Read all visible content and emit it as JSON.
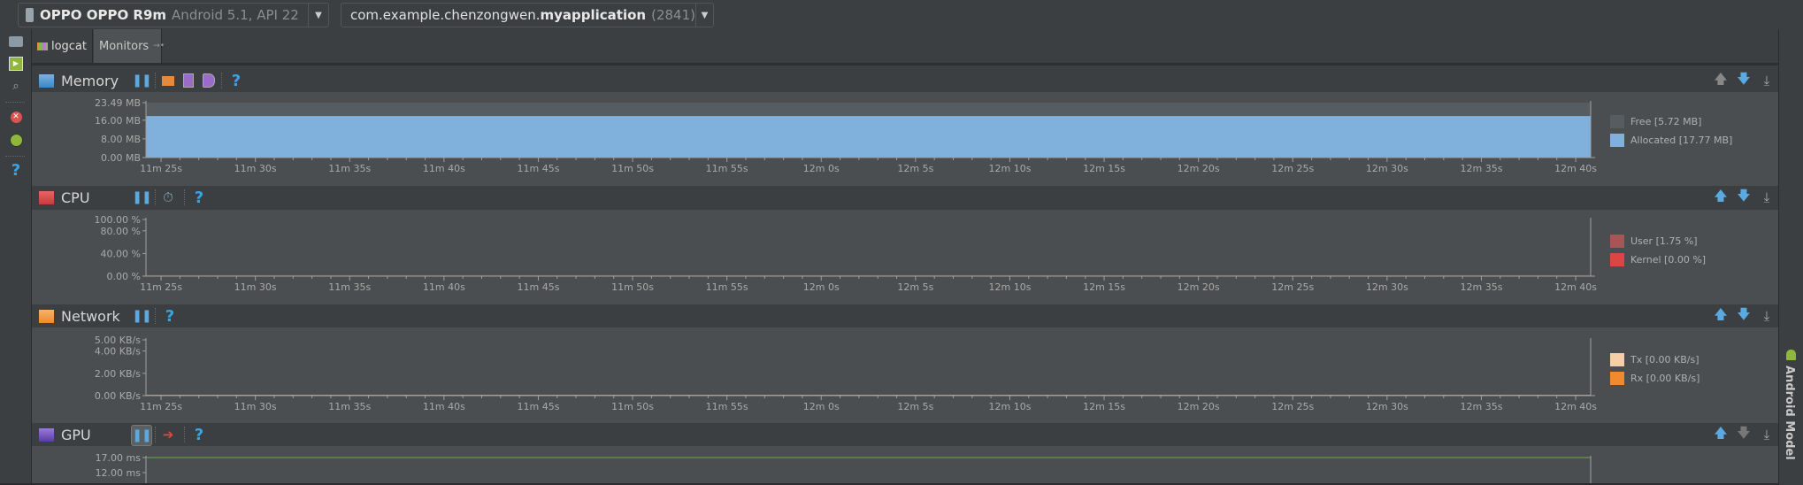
{
  "topbar": {
    "device": {
      "name": "OPPO OPPO R9m",
      "detail": "Android 5.1, API 22"
    },
    "process": {
      "name_plain": "com.example.chenzongwen.",
      "name_bold": "myapplication",
      "pid": "(2841)"
    }
  },
  "left_toolbar": [
    "screenshot-icon",
    "screen-record-icon",
    "layout-inspector-icon",
    "terminate-icon",
    "system-info-icon",
    "help-icon"
  ],
  "tabs": [
    {
      "label": "logcat"
    },
    {
      "label": "Monitors",
      "active": true
    }
  ],
  "panels": {
    "memory": {
      "title": "Memory"
    },
    "cpu": {
      "title": "CPU"
    },
    "network": {
      "title": "Network"
    },
    "gpu": {
      "title": "GPU"
    }
  },
  "right_strip": {
    "label": "Android Model"
  },
  "chart_data": [
    {
      "id": "memory",
      "type": "area",
      "x_ticks": [
        "11m 25s",
        "11m 30s",
        "11m 35s",
        "11m 40s",
        "11m 45s",
        "11m 50s",
        "11m 55s",
        "12m 0s",
        "12m 5s",
        "12m 10s",
        "12m 15s",
        "12m 20s",
        "12m 25s",
        "12m 30s",
        "12m 35s",
        "12m 40s"
      ],
      "y_ticks": [
        {
          "v": 0,
          "label": "0.00 MB"
        },
        {
          "v": 8,
          "label": "8.00 MB"
        },
        {
          "v": 16,
          "label": "16.00 MB"
        },
        {
          "v": 23.49,
          "label": "23.49 MB"
        }
      ],
      "ylim": [
        0,
        23.49
      ],
      "series": [
        {
          "name": "Free",
          "legend": "Free [5.72 MB]",
          "value": 5.72,
          "color": "#575c60"
        },
        {
          "name": "Allocated",
          "legend": "Allocated [17.77 MB]",
          "value": 17.77,
          "color": "#80b0dc"
        }
      ]
    },
    {
      "id": "cpu",
      "type": "area",
      "x_ticks": [
        "11m 25s",
        "11m 30s",
        "11m 35s",
        "11m 40s",
        "11m 45s",
        "11m 50s",
        "11m 55s",
        "12m 0s",
        "12m 5s",
        "12m 10s",
        "12m 15s",
        "12m 20s",
        "12m 25s",
        "12m 30s",
        "12m 35s",
        "12m 40s"
      ],
      "y_ticks": [
        {
          "v": 0,
          "label": "0.00 %"
        },
        {
          "v": 40,
          "label": "40.00 %"
        },
        {
          "v": 80,
          "label": "80.00 %"
        },
        {
          "v": 100,
          "label": "100.00 %"
        }
      ],
      "ylim": [
        0,
        100
      ],
      "series": [
        {
          "name": "User",
          "legend": "User [1.75 %]",
          "value": 1.75,
          "color": "#a85555"
        },
        {
          "name": "Kernel",
          "legend": "Kernel [0.00 %]",
          "value": 0,
          "color": "#dd4444"
        }
      ]
    },
    {
      "id": "network",
      "type": "area",
      "x_ticks": [
        "11m 25s",
        "11m 30s",
        "11m 35s",
        "11m 40s",
        "11m 45s",
        "11m 50s",
        "11m 55s",
        "12m 0s",
        "12m 5s",
        "12m 10s",
        "12m 15s",
        "12m 20s",
        "12m 25s",
        "12m 30s",
        "12m 35s",
        "12m 40s"
      ],
      "y_ticks": [
        {
          "v": 0,
          "label": "0.00 KB/s"
        },
        {
          "v": 2,
          "label": "2.00 KB/s"
        },
        {
          "v": 4,
          "label": "4.00 KB/s"
        },
        {
          "v": 5,
          "label": "5.00 KB/s"
        }
      ],
      "ylim": [
        0,
        5
      ],
      "series": [
        {
          "name": "Tx",
          "legend": "Tx [0.00 KB/s]",
          "value": 0,
          "color": "#f6cfa8"
        },
        {
          "name": "Rx",
          "legend": "Rx [0.00 KB/s]",
          "value": 0,
          "color": "#f08a2c"
        }
      ]
    },
    {
      "id": "gpu",
      "type": "line",
      "y_ticks": [
        {
          "v": 12,
          "label": "12.00 ms"
        },
        {
          "v": 17,
          "label": "17.00 ms"
        }
      ],
      "threshold_color": "#6aa84f"
    }
  ],
  "colors": {
    "accent": "#3aa3e3",
    "background": "#3c3f41",
    "chart_bg": "#4b4e50"
  }
}
